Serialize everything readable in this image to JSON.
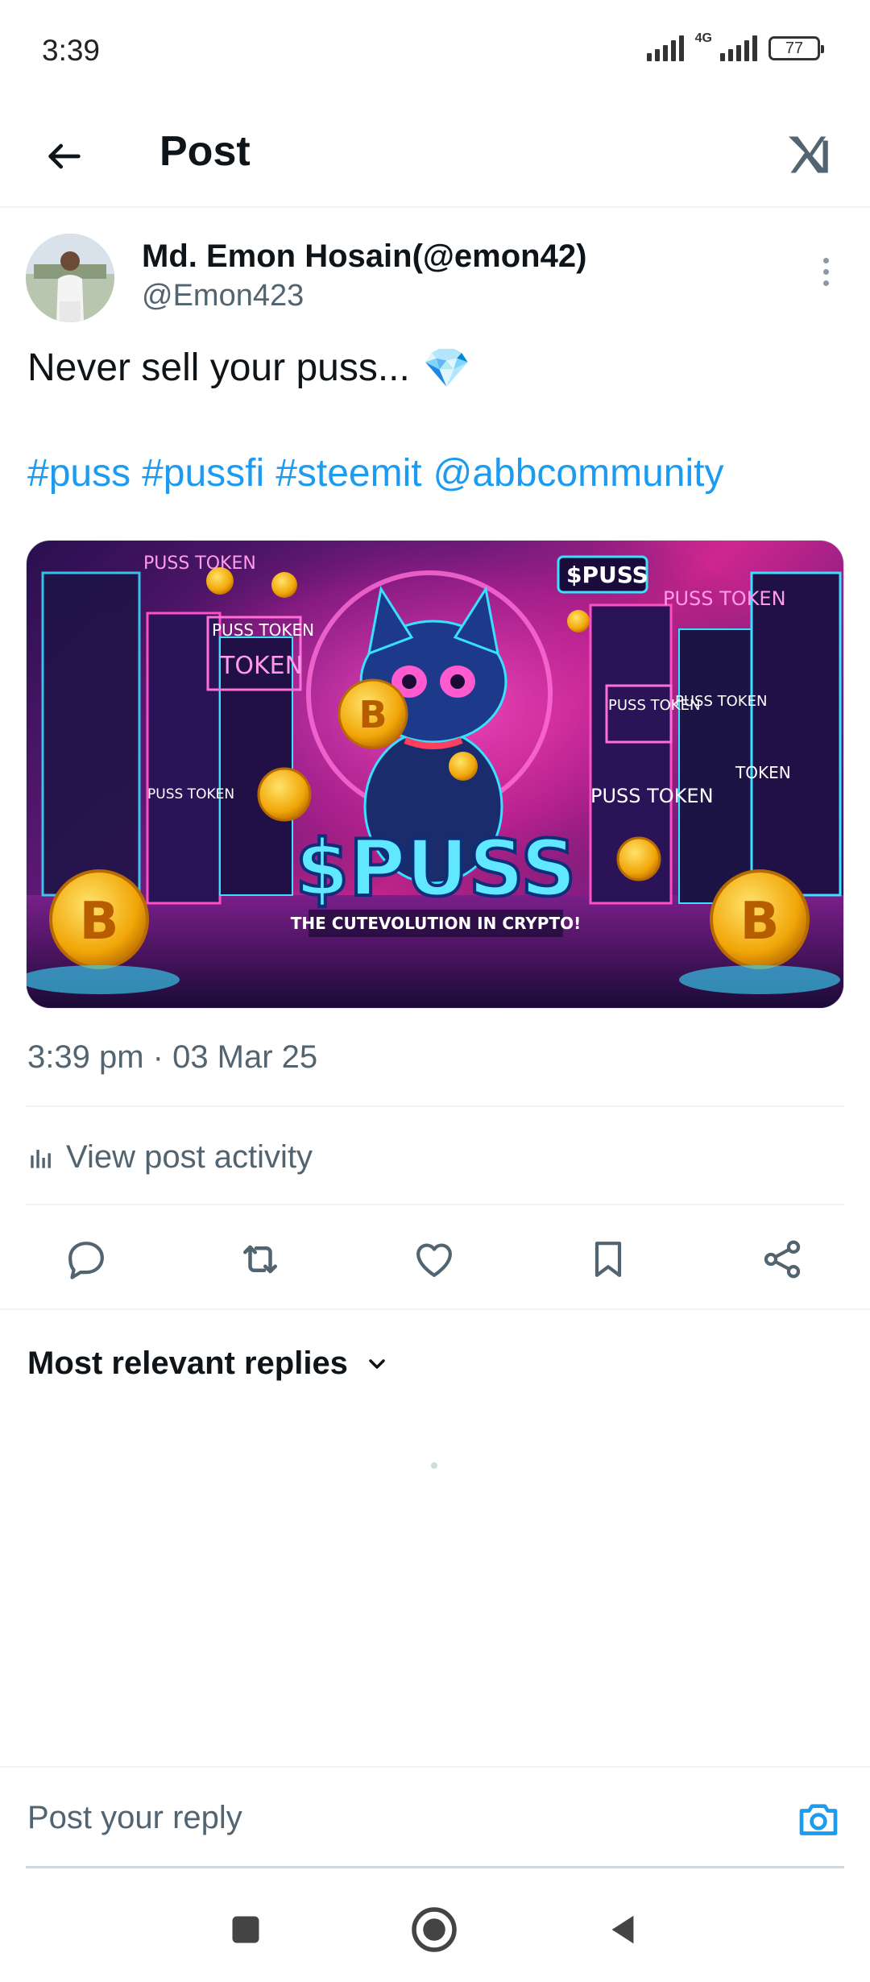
{
  "status_bar": {
    "time": "3:39",
    "network": "4G",
    "battery": "77"
  },
  "header": {
    "title": "Post",
    "back_icon": "arrow-left-icon",
    "logo_icon": "x-app-logo-icon"
  },
  "post": {
    "author_name": "Md. Emon Hosain(@emon42)",
    "author_handle": "@Emon423",
    "text": "Never sell your puss...",
    "emoji": "💎",
    "hashtags": [
      "#puss",
      "#pussfi",
      "#steemit",
      "@abbcommunity"
    ],
    "timestamp": "3:39 pm · 03 Mar 25",
    "activity_label": "View post activity",
    "media": {
      "title": "$PUSS",
      "subtitle": "THE CUTEVOLUTION IN CRYPTO!",
      "labels": [
        "PUSS TOKEN",
        "PUSS TOKEN",
        "TOKEN",
        "$PUSS",
        "PUSS TOKEN",
        "PUSS TOKEN",
        "PUSS TOKEN",
        "PUSS TOKEN",
        "PUSS TOKEN",
        "TOKEN"
      ]
    }
  },
  "actions": {
    "reply_icon": "reply-icon",
    "repost_icon": "repost-icon",
    "like_icon": "heart-icon",
    "bookmark_icon": "bookmark-icon",
    "share_icon": "share-icon"
  },
  "replies": {
    "sort_label": "Most relevant replies"
  },
  "reply_bar": {
    "placeholder": "Post your reply"
  },
  "colors": {
    "accent": "#1d9bf0",
    "secondary_text": "#536471",
    "primary_text": "#0f1419"
  }
}
